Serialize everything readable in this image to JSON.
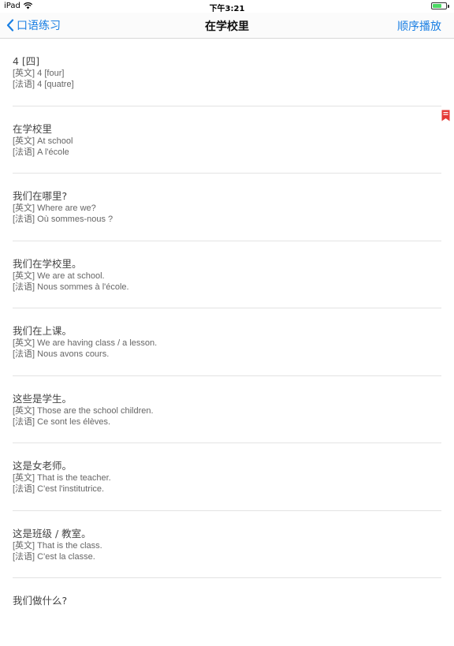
{
  "status_bar": {
    "device": "iPad",
    "time": "下午3:21"
  },
  "nav": {
    "back_label": "口语练习",
    "title": "在学校里",
    "action_label": "顺序播放"
  },
  "colors": {
    "accent": "#1a7fe3",
    "bookmark": "#e53935",
    "battery": "#4cd964"
  },
  "items": [
    {
      "zh": "4 [四]",
      "en": "[英文] 4 [four]",
      "fr": "[法语] 4 [quatre]"
    },
    {
      "zh": "在学校里",
      "en": "[英文] At school",
      "fr": "[法语] A l'école",
      "bookmarked": true
    },
    {
      "zh": "我们在哪里?",
      "en": "[英文] Where are we?",
      "fr": "[法语] Où sommes-nous ?"
    },
    {
      "zh": "我们在学校里。",
      "en": "[英文] We are at school.",
      "fr": "[法语] Nous sommes à l'école."
    },
    {
      "zh": "我们在上课。",
      "en": "[英文] We are having class / a lesson.",
      "fr": "[法语] Nous avons cours."
    },
    {
      "zh": "这些是学生。",
      "en": "[英文] Those are the school children.",
      "fr": "[法语] Ce sont les élèves."
    },
    {
      "zh": "这是女老师。",
      "en": "[英文] That is the teacher.",
      "fr": "[法语] C'est l'institutrice."
    },
    {
      "zh": "这是班级 / 教室。",
      "en": "[英文] That is the class.",
      "fr": "[法语] C'est la classe."
    },
    {
      "zh": "我们做什么?",
      "en": "",
      "fr": ""
    }
  ]
}
